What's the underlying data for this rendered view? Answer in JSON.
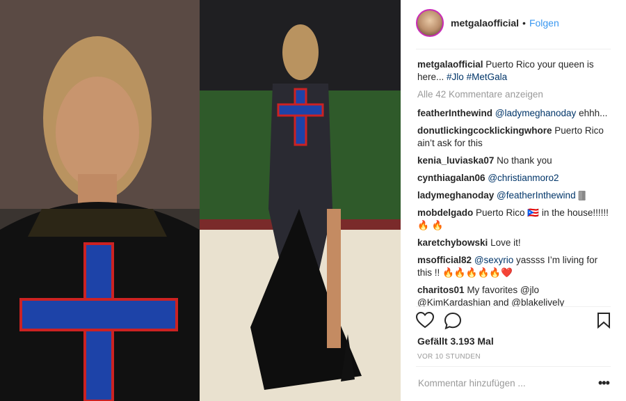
{
  "account": {
    "username": "metgalaofficial",
    "separator": "•",
    "follow_label": "Folgen"
  },
  "caption": {
    "username": "metgalaofficial",
    "text": "Puerto Rico your queen is here...",
    "hashtags": [
      "#Jlo",
      "#MetGala"
    ]
  },
  "view_all_comments": "Alle 42 Kommentare anzeigen",
  "comments": [
    {
      "user": "featherInthewind",
      "mention": "@ladymeghanoday",
      "text": "ehhh..."
    },
    {
      "user": "donutlickingcocklickingwhore",
      "mention": "",
      "text": "Puerto Rico ain’t ask for this"
    },
    {
      "user": "kenia_luviaska07",
      "mention": "",
      "text": "No thank you"
    },
    {
      "user": "cynthiagalan06",
      "mention": "@christianmoro2",
      "text": ""
    },
    {
      "user": "ladymeghanoday",
      "mention": "@featherInthewind",
      "text": "🀫"
    },
    {
      "user": "mobdelgado",
      "mention": "",
      "text": "Puerto Rico 🇵🇷 in the house!!!!!! 🔥 🔥"
    },
    {
      "user": "karetchybowski",
      "mention": "",
      "text": "Love it!"
    },
    {
      "user": "msofficial82",
      "mention": "@sexyrio",
      "text": "yassss I’m living for this !! 🔥🔥🔥🔥🔥❤️"
    },
    {
      "user": "charitos01",
      "mention": "",
      "text": "My favorites @jlo @KimKardashian and @blakelively"
    }
  ],
  "actions": {
    "like_icon": "heart-icon",
    "comment_icon": "comment-bubble-icon",
    "save_icon": "bookmark-icon"
  },
  "likes_text": "Gefällt 3.193 Mal",
  "timestamp": "VOR 10 STUNDEN",
  "add_comment_placeholder": "Kommentar hinzufügen ...",
  "more_options": "•••",
  "colors": {
    "link": "#003569",
    "follow": "#3897f0",
    "muted": "#999999",
    "avatar_ring": "#c92bb7"
  }
}
